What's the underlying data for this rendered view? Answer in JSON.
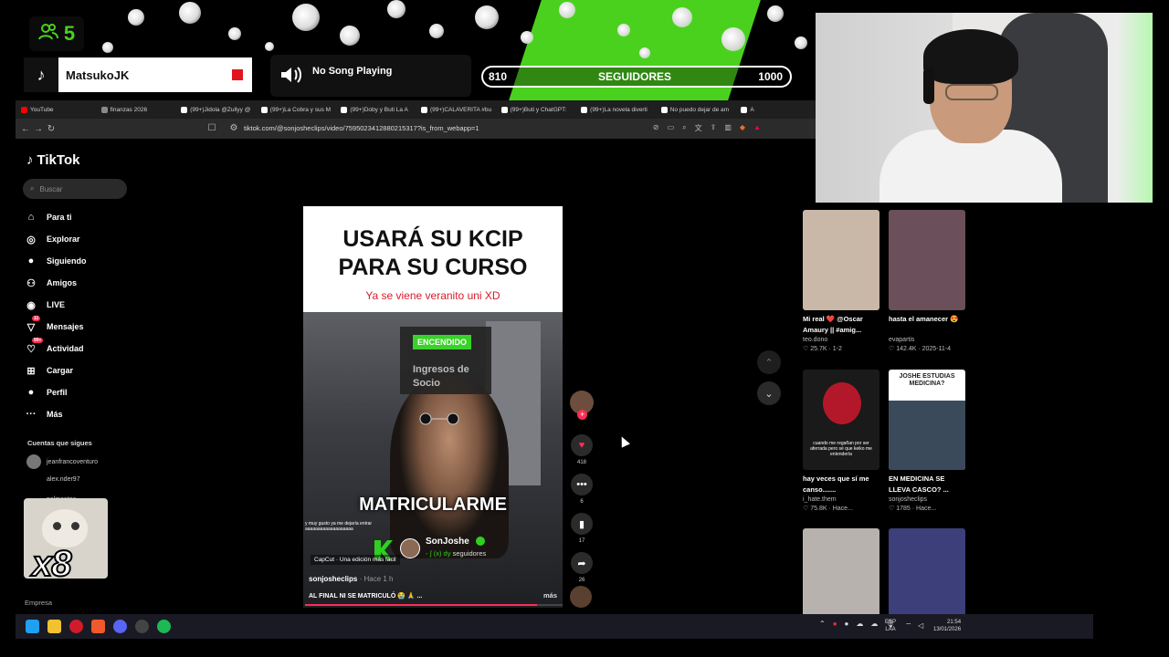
{
  "overlay": {
    "viewer_count": "5",
    "tiktok_user": "MatsukoJK",
    "song_status": "No Song Playing",
    "followers": {
      "current": "810",
      "label": "SEGUIDORES",
      "goal": "1000",
      "progress": 0.0
    }
  },
  "browser": {
    "tabs": [
      {
        "label": "YouTube",
        "color": "#ff0000"
      },
      {
        "label": "finanzas 2026",
        "color": "#8a8a8a"
      },
      {
        "label": "(99+)Jidola @Zullyy @",
        "color": "#ffffff"
      },
      {
        "label": "(99+)La Cobra y sus M",
        "color": "#ffffff"
      },
      {
        "label": "(99+)Doby y Buti La A",
        "color": "#ffffff"
      },
      {
        "label": "(99+)CALAVERITA #bu",
        "color": "#ffffff"
      },
      {
        "label": "(99+)Buti y ChatGPT:",
        "color": "#ffffff"
      },
      {
        "label": "(99+)La novela diverti",
        "color": "#ffffff"
      },
      {
        "label": "No puedo dejar de am",
        "color": "#ffffff"
      },
      {
        "label": "A",
        "color": "#ffffff"
      }
    ],
    "url": "tiktok.com/@sonjosheclips/video/7595023412880215317?is_from_webapp=1"
  },
  "tiktok": {
    "logo": "TikTok",
    "search_placeholder": "Buscar",
    "nav": [
      {
        "label": "Para ti",
        "icon": "home-icon",
        "glyph": "⌂",
        "badge": ""
      },
      {
        "label": "Explorar",
        "icon": "compass-icon",
        "glyph": "◎",
        "badge": ""
      },
      {
        "label": "Siguiendo",
        "icon": "following-avatar-icon",
        "glyph": "●",
        "badge": ""
      },
      {
        "label": "Amigos",
        "icon": "friends-icon",
        "glyph": "⚇",
        "badge": ""
      },
      {
        "label": "LIVE",
        "icon": "live-icon",
        "glyph": "◉",
        "badge": ""
      },
      {
        "label": "Mensajes",
        "icon": "messages-icon",
        "glyph": "▽",
        "badge": "11"
      },
      {
        "label": "Actividad",
        "icon": "activity-icon",
        "glyph": "♡",
        "badge": "99+"
      },
      {
        "label": "Cargar",
        "icon": "upload-icon",
        "glyph": "⊞",
        "badge": ""
      },
      {
        "label": "Perfil",
        "icon": "profile-icon",
        "glyph": "●",
        "badge": ""
      },
      {
        "label": "Más",
        "icon": "more-icon",
        "glyph": "···",
        "badge": ""
      }
    ],
    "follows_title": "Cuentas que sigues",
    "follows": [
      {
        "name": "jeanfrancoventuro"
      },
      {
        "name": "alex.nder97"
      },
      {
        "name": "palmentos"
      }
    ],
    "footer": "Empresa",
    "video": {
      "title": "USARÁ SU KCIP PARA SU CURSO",
      "subtitle": "Ya se viene veranito uni XD",
      "overlay_tag": "ENCENDIDO",
      "overlay_text": "Ingresos de Socio",
      "big_caption": "MATRICULARME",
      "small_caption": "y muy gusto ya me dejaría entrar aaaaaaaaaaaaaaaaaaa",
      "capcut": "CapCut · Una edición más fácil",
      "creator": "SonJoshe",
      "creator_sub": "- ∫ (x) dy",
      "creator_sub2": "seguidores",
      "author": "sonjosheclips",
      "time": "· Hace 1 h",
      "caption": "AL FINAL NI SE MATRICULÓ 😭 🙏 ...",
      "more": "más",
      "progress": 0.9
    },
    "actions": {
      "likes": "418",
      "comments": "6",
      "saves": "17",
      "shares": "26"
    },
    "related": [
      {
        "title": "Mi real ❤️ @Oscar Amaury || #amig...",
        "author": "teo.dono",
        "meta": "♡ 25.7K · 1-2",
        "bg": "#c9b7a8"
      },
      {
        "title": "hasta el amanecer 😍",
        "author": "evapartis",
        "meta": "♡ 142.4K · 2025-11-4",
        "bg": "#6b4f5a"
      },
      {
        "title": "hay veces que sí me canso.......",
        "author": "i_hate.them",
        "meta": "♡ 75.8K · Hace...",
        "bg": "#1a1a1a"
      },
      {
        "title": "EN MEDICINA SE LLEVA CASCO? ...",
        "author": "sonjosheclips",
        "meta": "♡ 1785 · Hace...",
        "bg": "#ffffff"
      },
      {
        "title": "",
        "author": "",
        "meta": "",
        "bg": "#b7b2ad"
      },
      {
        "title": "",
        "author": "",
        "meta": "",
        "bg": "#3c3f7a"
      }
    ],
    "related_text": {
      "card3_caption": "cuando me regañan por ser aferrada pero sé que keiko me entendería",
      "card4_header": "JOSHE ESTUDIAS MEDICINA?"
    }
  },
  "emote": {
    "text": "x8"
  },
  "taskbar": {
    "language": "ESP",
    "language_sub": "LAA",
    "time": "21:54",
    "date": "13/01/2026"
  }
}
